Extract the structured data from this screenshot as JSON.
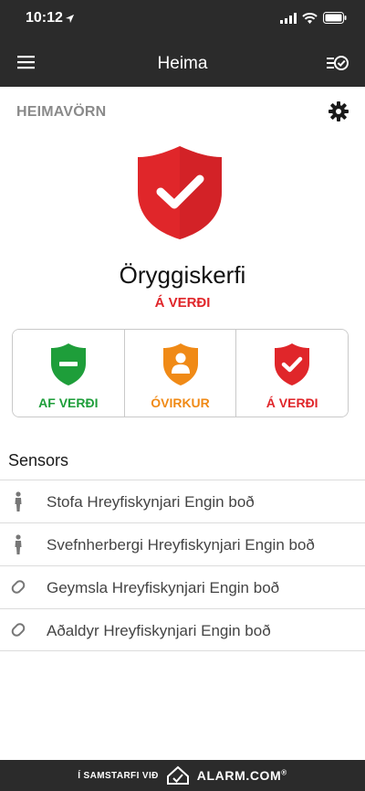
{
  "status_bar": {
    "time": "10:12"
  },
  "nav": {
    "title": "Heima"
  },
  "section": {
    "label": "HEIMAVÖRN"
  },
  "system": {
    "name": "Öryggiskerfi",
    "state": "Á VERÐI",
    "state_color": "#e0262a"
  },
  "arm_buttons": [
    {
      "label": "AF VERÐI",
      "color": "#1e9e3a",
      "icon": "shield-minus-icon"
    },
    {
      "label": "ÓVIRKUR",
      "color": "#f08a16",
      "icon": "shield-person-icon"
    },
    {
      "label": "Á VERÐI",
      "color": "#e0262a",
      "icon": "shield-check-icon"
    }
  ],
  "sensors": {
    "title": "Sensors",
    "items": [
      {
        "text": "Stofa Hreyfiskynjari Engin boð",
        "icon": "person-icon"
      },
      {
        "text": "Svefnherbergi Hreyfiskynjari Engin boð",
        "icon": "person-icon"
      },
      {
        "text": "Geymsla Hreyfiskynjari Engin boð",
        "icon": "pill-icon"
      },
      {
        "text": "Aðaldyr Hreyfiskynjari Engin boð",
        "icon": "pill-icon"
      }
    ]
  },
  "footer": {
    "partner_text": "Í SAMSTARFI VIÐ",
    "brand": "ALARM.COM",
    "brand_mark": "®"
  }
}
